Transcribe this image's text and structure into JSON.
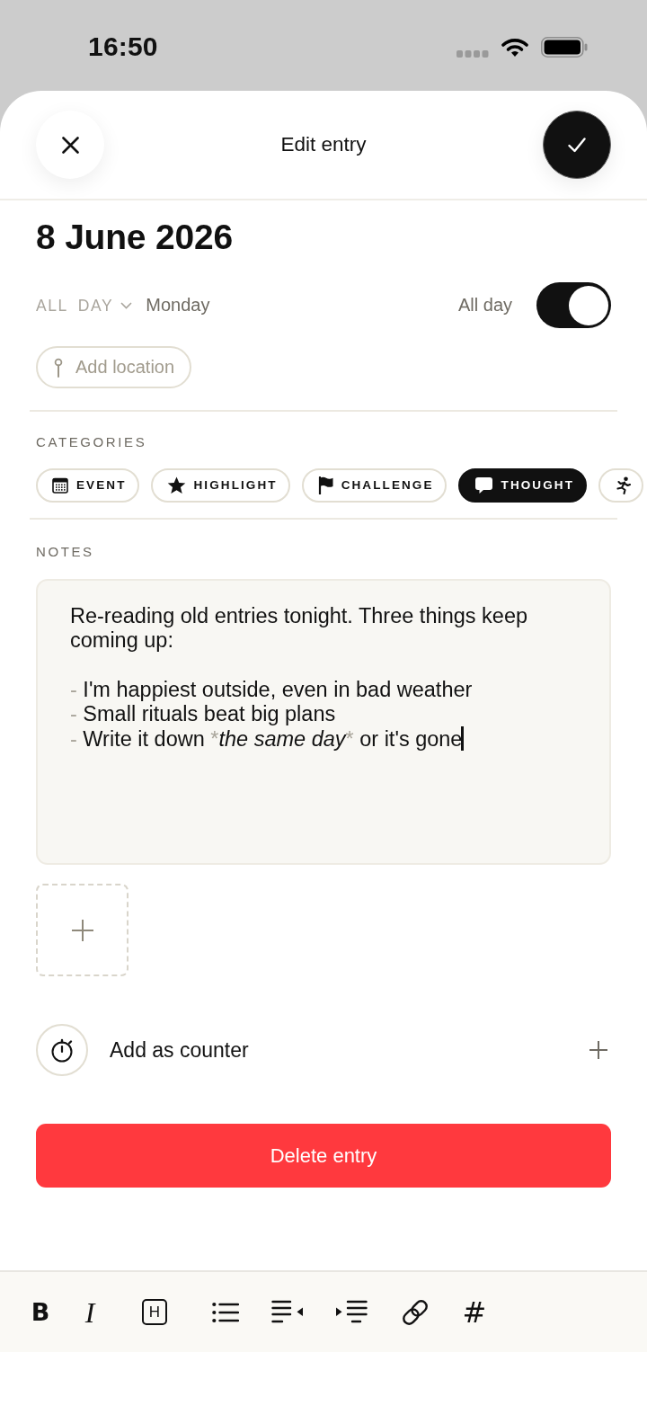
{
  "status_bar": {
    "time": "16:50"
  },
  "header": {
    "title": "Edit entry"
  },
  "entry": {
    "date": "8 June 2026",
    "time": {
      "label": "ALL DAY",
      "disabled": true
    },
    "weekday": "Monday",
    "all_day": {
      "label": "All day",
      "on": true
    },
    "location": {
      "label": "Add location"
    }
  },
  "categories": {
    "heading": "CATEGORIES",
    "items": [
      {
        "label": "EVENT",
        "selected": false
      },
      {
        "label": "HIGHLIGHT",
        "selected": false
      },
      {
        "label": "CHALLENGE",
        "selected": false
      },
      {
        "label": "THOUGHT",
        "selected": true
      },
      {
        "selected": false
      }
    ]
  },
  "notes": {
    "heading": "NOTES",
    "value": "Re-reading old entries tonight. Three things keep coming up:\n\n- I'm happiest outside, even in bad weather\n- Small rituals beat big plans\n- Write it down *the same day* or it's gone",
    "focused": true
  },
  "counter": {
    "label": "Add as counter"
  },
  "delete_button": {
    "label": "Delete entry"
  },
  "toolbar": [
    {
      "kind": "bold",
      "label": "B"
    },
    {
      "kind": "italic",
      "label": "I"
    },
    {
      "kind": "heading",
      "label": "H"
    },
    {
      "kind": "bullets"
    },
    {
      "kind": "outdent"
    },
    {
      "kind": "indent"
    },
    {
      "kind": "link"
    },
    {
      "kind": "tag",
      "label": "#"
    }
  ]
}
